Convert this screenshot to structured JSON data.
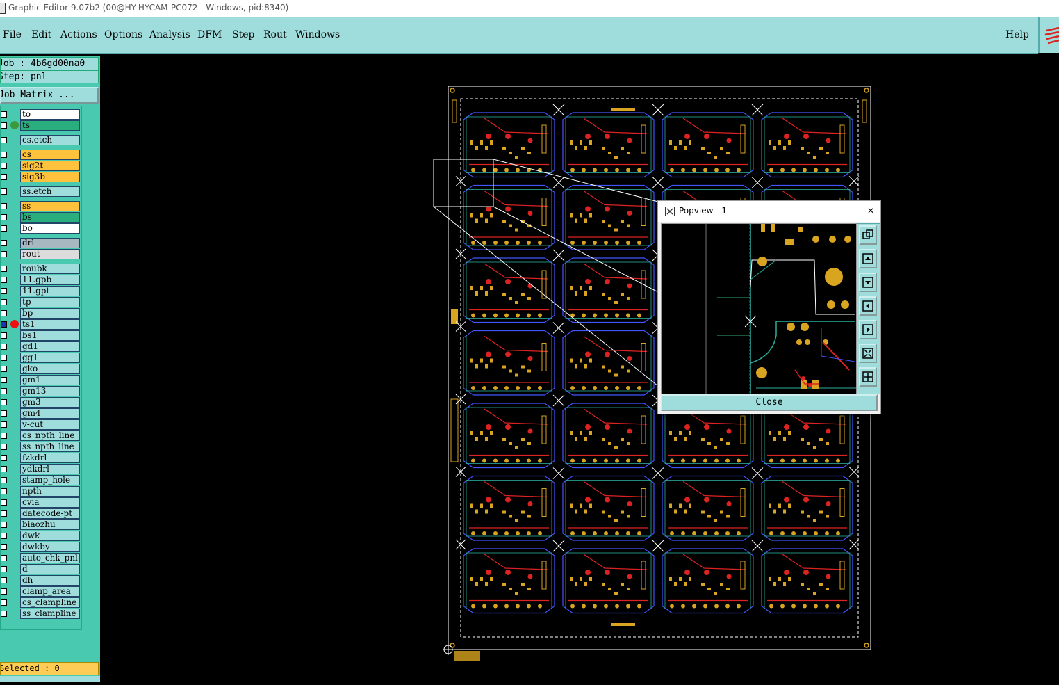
{
  "window": {
    "title": "Graphic Editor 9.07b2 (00@HY-HYCAM-PC072 - Windows, pid:8340)"
  },
  "menu": {
    "items": [
      {
        "label": "File"
      },
      {
        "label": "Edit"
      },
      {
        "label": "Actions"
      },
      {
        "label": "Options"
      },
      {
        "label": "Analysis"
      },
      {
        "label": "DFM"
      },
      {
        "label": "Step"
      },
      {
        "label": "Rout"
      },
      {
        "label": "Windows"
      }
    ],
    "help": "Help"
  },
  "job": {
    "job_label": "Job : 4b6gd00na0",
    "step_label": "Step: pnl",
    "matrix_button": "Job Matrix ..."
  },
  "layers": [
    {
      "name": "to",
      "color": "#ffffff"
    },
    {
      "name": "ts",
      "color": "#2bae7e",
      "dot": "#3a9a3a"
    },
    {
      "name": "cs.etch",
      "color": "#9fdcdc"
    },
    {
      "name": "cs",
      "color": "#ffc23c"
    },
    {
      "name": "sig2t",
      "color": "#ffc23c"
    },
    {
      "name": "sig3b",
      "color": "#ffc23c"
    },
    {
      "name": "ss.etch",
      "color": "#9fdcdc"
    },
    {
      "name": "ss",
      "color": "#ffc23c"
    },
    {
      "name": "bs",
      "color": "#2bae7e"
    },
    {
      "name": "bo",
      "color": "#ffffff"
    },
    {
      "name": "drl",
      "color": "#a8b8c0"
    },
    {
      "name": "rout",
      "color": "#dcdcdc"
    },
    {
      "name": "roubk",
      "color": "#9fdcdc"
    },
    {
      "name": "11.gpb",
      "color": "#9fdcdc"
    },
    {
      "name": "11.gpt",
      "color": "#9fdcdc"
    },
    {
      "name": "tp",
      "color": "#9fdcdc"
    },
    {
      "name": "bp",
      "color": "#9fdcdc"
    },
    {
      "name": "ts1",
      "color": "#9fdcdc",
      "dot": "#ee1111",
      "active": true
    },
    {
      "name": "bs1",
      "color": "#9fdcdc"
    },
    {
      "name": "gd1",
      "color": "#9fdcdc"
    },
    {
      "name": "gg1",
      "color": "#9fdcdc"
    },
    {
      "name": "gko",
      "color": "#9fdcdc"
    },
    {
      "name": "gm1",
      "color": "#9fdcdc"
    },
    {
      "name": "gm13",
      "color": "#9fdcdc"
    },
    {
      "name": "gm3",
      "color": "#9fdcdc"
    },
    {
      "name": "gm4",
      "color": "#9fdcdc"
    },
    {
      "name": "v-cut",
      "color": "#9fdcdc"
    },
    {
      "name": "cs_npth_line",
      "color": "#9fdcdc"
    },
    {
      "name": "ss_npth_line",
      "color": "#9fdcdc"
    },
    {
      "name": "fzkdrl",
      "color": "#9fdcdc"
    },
    {
      "name": "ydkdrl",
      "color": "#9fdcdc"
    },
    {
      "name": "stamp_hole",
      "color": "#9fdcdc"
    },
    {
      "name": "npth",
      "color": "#9fdcdc"
    },
    {
      "name": "cvia",
      "color": "#9fdcdc"
    },
    {
      "name": "datecode-pt",
      "color": "#9fdcdc"
    },
    {
      "name": "biaozhu",
      "color": "#9fdcdc"
    },
    {
      "name": "dwk",
      "color": "#9fdcdc"
    },
    {
      "name": "dwkby",
      "color": "#9fdcdc"
    },
    {
      "name": "auto_chk_pnl",
      "color": "#9fdcdc"
    },
    {
      "name": "d",
      "color": "#9fdcdc"
    },
    {
      "name": "dh",
      "color": "#9fdcdc"
    },
    {
      "name": "clamp_area",
      "color": "#9fdcdc"
    },
    {
      "name": "cs_clampline",
      "color": "#9fdcdc"
    },
    {
      "name": "ss_clampline",
      "color": "#9fdcdc"
    }
  ],
  "status": {
    "selected_label": "Selected : 0"
  },
  "popview": {
    "title": "Popview - 1",
    "close_button": "Close",
    "close_icon": "×",
    "tools": [
      "zoom-home-icon",
      "pan-up-icon",
      "pan-down-icon",
      "pan-left-icon",
      "pan-right-icon",
      "zoom-in-icon",
      "zoom-out-icon"
    ]
  },
  "board": {
    "panel_grid": {
      "rows": 7,
      "cols": 4
    },
    "colors": {
      "background": "#000000",
      "outline": "#ffffff",
      "trace_red": "#dd2222",
      "pad_yellow": "#d9a520",
      "outline_blue": "#4455ff",
      "outline_cyan": "#2bae9e"
    }
  }
}
